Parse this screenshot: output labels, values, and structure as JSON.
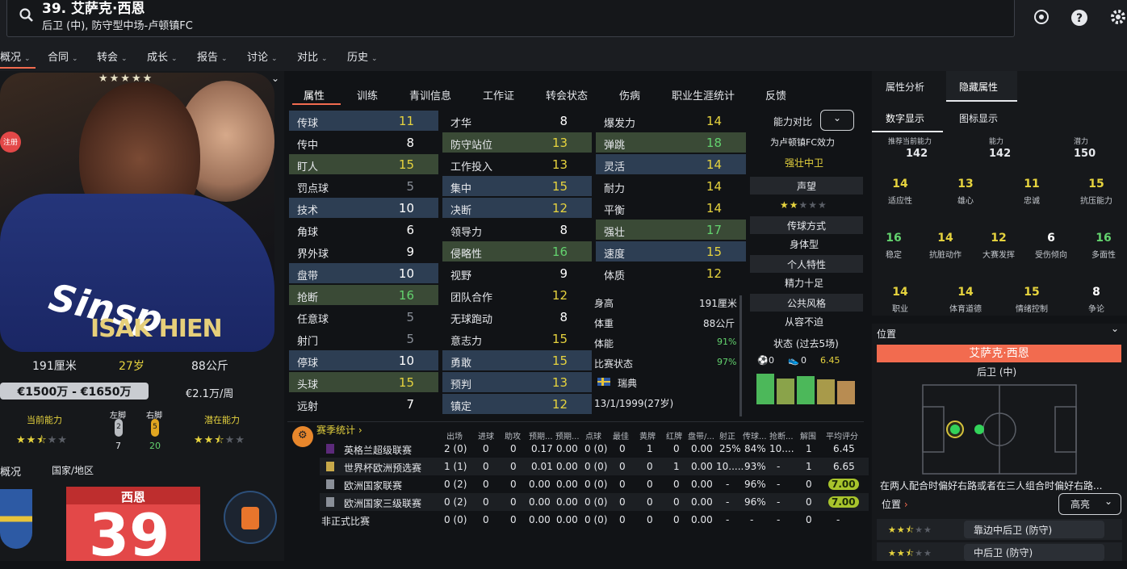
{
  "header": {
    "title": "39. 艾萨克·西恩",
    "subtitle": "后卫 (中), 防守型中场-卢顿镇FC"
  },
  "nav": [
    {
      "label": "概况"
    },
    {
      "label": "合同"
    },
    {
      "label": "转会"
    },
    {
      "label": "成长"
    },
    {
      "label": "报告"
    },
    {
      "label": "讨论"
    },
    {
      "label": "对比"
    },
    {
      "label": "历史"
    }
  ],
  "player_card": {
    "badge": "注册",
    "name_on_shirt": "ISAK HIEN",
    "height": "191厘米",
    "age": "27岁",
    "weight": "88公斤",
    "value": "€1500万 - €1650万",
    "wage": "€2.1万/周",
    "current_ability_label": "当前能力",
    "potential_ability_label": "潜在能力",
    "left_foot_label": "左脚",
    "right_foot_label": "右脚",
    "left_foot_rating": "2",
    "right_foot_rating": "5",
    "left_foot_value": "7",
    "right_foot_value": "20",
    "tab_overview": "概况",
    "tab_nation": "国家/地区",
    "shirt_name": "西恩",
    "shirt_number": "39",
    "stars_current": 2.5,
    "stars_potential": 2.5
  },
  "attr_tabs": [
    "属性",
    "训练",
    "青训信息",
    "工作证",
    "转会状态",
    "伤病",
    "职业生涯统计",
    "反馈"
  ],
  "technical": [
    {
      "name": "传球",
      "value": "11"
    },
    {
      "name": "传中",
      "value": "8"
    },
    {
      "name": "盯人",
      "value": "15"
    },
    {
      "name": "罚点球",
      "value": "5"
    },
    {
      "name": "技术",
      "value": "10"
    },
    {
      "name": "角球",
      "value": "6"
    },
    {
      "name": "界外球",
      "value": "9"
    },
    {
      "name": "盘带",
      "value": "10"
    },
    {
      "name": "抢断",
      "value": "16"
    },
    {
      "name": "任意球",
      "value": "5"
    },
    {
      "name": "射门",
      "value": "5"
    },
    {
      "name": "停球",
      "value": "10"
    },
    {
      "name": "头球",
      "value": "15"
    },
    {
      "name": "远射",
      "value": "7"
    }
  ],
  "mental": [
    {
      "name": "才华",
      "value": "8"
    },
    {
      "name": "防守站位",
      "value": "13"
    },
    {
      "name": "工作投入",
      "value": "13"
    },
    {
      "name": "集中",
      "value": "15"
    },
    {
      "name": "决断",
      "value": "12"
    },
    {
      "name": "领导力",
      "value": "8"
    },
    {
      "name": "侵略性",
      "value": "16"
    },
    {
      "name": "视野",
      "value": "9"
    },
    {
      "name": "团队合作",
      "value": "12"
    },
    {
      "name": "无球跑动",
      "value": "8"
    },
    {
      "name": "意志力",
      "value": "15"
    },
    {
      "name": "勇敢",
      "value": "15"
    },
    {
      "name": "预判",
      "value": "13"
    },
    {
      "name": "镇定",
      "value": "12"
    }
  ],
  "physical": [
    {
      "name": "爆发力",
      "value": "14"
    },
    {
      "name": "弹跳",
      "value": "18"
    },
    {
      "name": "灵活",
      "value": "14"
    },
    {
      "name": "耐力",
      "value": "14"
    },
    {
      "name": "平衡",
      "value": "14"
    },
    {
      "name": "强壮",
      "value": "17"
    },
    {
      "name": "速度",
      "value": "15"
    },
    {
      "name": "体质",
      "value": "12"
    }
  ],
  "bio": {
    "height_label": "身高",
    "height": "191厘米",
    "weight_label": "体重",
    "weight": "88公斤",
    "fitness_label": "体能",
    "fitness": "91%",
    "match_label": "比赛状态",
    "match": "97%",
    "nation": "瑞典",
    "dob": "13/1/1999(27岁)"
  },
  "side": {
    "compare_label": "能力对比",
    "played_for": "为卢顿镇FC效力",
    "role": "强壮中卫",
    "reputation_label": "声望",
    "passing_style_label": "传球方式",
    "passing_style": "身体型",
    "personality_label": "个人特性",
    "personality": "精力十足",
    "media_label": "公共风格",
    "media": "从容不迫",
    "form_label": "状态 (过去5场)",
    "form_goals": "0",
    "form_assists": "0",
    "form_rating": "6.45"
  },
  "season": {
    "title": "赛季统计",
    "headers": [
      "出场",
      "进球",
      "助攻",
      "预期...",
      "预期...",
      "点球",
      "最佳",
      "黄牌",
      "红牌",
      "盘带/...",
      "射正",
      "传球...",
      "抢断...",
      "解围",
      "平均评分"
    ],
    "rows": [
      {
        "comp": "英格兰超级联赛",
        "cells": [
          "2 (0)",
          "0",
          "0",
          "0.17",
          "0.00",
          "0 (0)",
          "0",
          "1",
          "0",
          "0.00",
          "25%",
          "84%",
          "10....",
          "1",
          "6.45"
        ]
      },
      {
        "comp": "世界杯欧洲预选赛",
        "cells": [
          "1 (1)",
          "0",
          "0",
          "0.01",
          "0.00",
          "0 (0)",
          "0",
          "0",
          "1",
          "0.00",
          "10.....",
          "93%",
          "-",
          "1",
          "6.65"
        ]
      },
      {
        "comp": "欧洲国家联赛",
        "cells": [
          "0 (2)",
          "0",
          "0",
          "0.00",
          "0.00",
          "0 (0)",
          "0",
          "0",
          "0",
          "0.00",
          "-",
          "96%",
          "-",
          "0",
          "7.00"
        ]
      },
      {
        "comp": "欧洲国家三级联赛",
        "cells": [
          "0 (2)",
          "0",
          "0",
          "0.00",
          "0.00",
          "0 (0)",
          "0",
          "0",
          "0",
          "0.00",
          "-",
          "96%",
          "-",
          "0",
          "7.00"
        ]
      },
      {
        "comp": "非正式比赛",
        "cells": [
          "0 (0)",
          "0",
          "0",
          "0.00",
          "0.00",
          "0 (0)",
          "0",
          "0",
          "0",
          "0.00",
          "-",
          "-",
          "-",
          "0",
          "-"
        ]
      }
    ]
  },
  "right": {
    "tab1": "属性分析",
    "tab2": "隐藏属性",
    "sub1": "数字显示",
    "sub2": "图标显示",
    "ability_headers": [
      "推荐当前能力",
      "能力",
      "潜力"
    ],
    "ability_values": [
      "142",
      "142",
      "150"
    ],
    "hidden": [
      {
        "v": "14",
        "l": "适应性",
        "c": "yellow"
      },
      {
        "v": "13",
        "l": "雄心",
        "c": "yellow"
      },
      {
        "v": "11",
        "l": "忠诚",
        "c": "yellow"
      },
      {
        "v": "15",
        "l": "抗压能力",
        "c": "yellow"
      },
      {
        "v": "16",
        "l": "稳定",
        "c": "green"
      },
      {
        "v": "14",
        "l": "抗脏动作",
        "c": "yellow",
        "lc": "red"
      },
      {
        "v": "12",
        "l": "大赛发挥",
        "c": "yellow"
      },
      {
        "v": "6",
        "l": "受伤倾向",
        "c": "white",
        "lc": "red"
      },
      {
        "v": "16",
        "l": "多面性",
        "c": "green"
      },
      {
        "v": "14",
        "l": "职业",
        "c": "yellow"
      },
      {
        "v": "14",
        "l": "体育道德",
        "c": "yellow"
      },
      {
        "v": "15",
        "l": "情绪控制",
        "c": "yellow"
      },
      {
        "v": "8",
        "l": "争论",
        "c": "white",
        "lc": "red"
      }
    ],
    "position_label": "位置",
    "position_name": "艾萨克·西恩",
    "position_role": "后卫 (中)",
    "position_note": "在两人配合时偏好右路或者在三人组合时偏好右路...",
    "position_sub": "位置",
    "highlight": "高亮",
    "roles": [
      {
        "label": "靠边中后卫 (防守)",
        "stars": 2.5
      },
      {
        "label": "中后卫 (防守)",
        "stars": 2.5
      }
    ]
  },
  "colors": {
    "accent_orange": "#f26b4f",
    "highlight_blue": "#2d3e53",
    "highlight_green": "#3a4a36",
    "value_yellow": "#e6d33e",
    "value_green": "#63d26e"
  }
}
